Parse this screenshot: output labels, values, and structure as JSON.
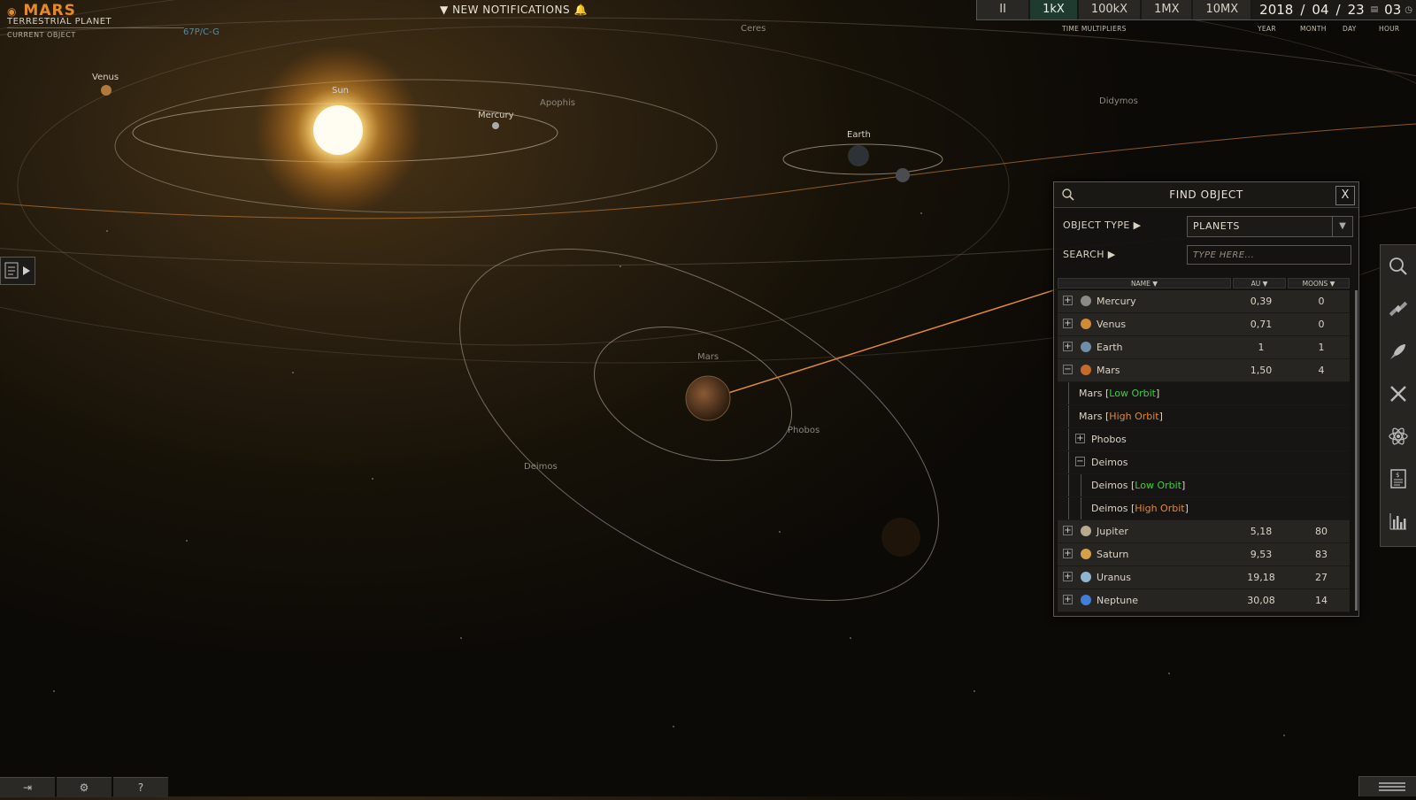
{
  "current_object": {
    "name": "MARS",
    "type": "TERRESTRIAL PLANET",
    "label": "CURRENT OBJECT",
    "code": "67P/C-G"
  },
  "notifications": {
    "label": "NEW NOTIFICATIONS"
  },
  "time_controls": {
    "pause": "II",
    "multipliers": [
      "1kX",
      "100kX",
      "1MX",
      "10MX"
    ],
    "active_multiplier": "1kX",
    "multipliers_label": "TIME MULTIPLIERS",
    "year": "2018",
    "month": "04",
    "day": "23",
    "hour": "03",
    "year_label": "YEAR",
    "month_label": "MONTH",
    "day_label": "DAY",
    "hour_label": "HOUR"
  },
  "scene_labels": {
    "venus": "Venus",
    "sun": "Sun",
    "mercury": "Mercury",
    "apophis": "Apophis",
    "ceres": "Ceres",
    "didymos": "Didymos",
    "earth": "Earth",
    "mars": "Mars",
    "phobos": "Phobos",
    "deimos": "Deimos"
  },
  "find_panel": {
    "title": "FIND OBJECT",
    "close": "X",
    "object_type_label": "OBJECT TYPE ▶",
    "object_type_value": "PLANETS",
    "search_label": "SEARCH ▶",
    "search_placeholder": "TYPE HERE...",
    "columns": {
      "name": "NAME ▼",
      "au": "AU ▼",
      "moons": "MOONS ▼"
    },
    "rows": [
      {
        "kind": "planet",
        "toggle": "+",
        "name": "Mercury",
        "au": "0,39",
        "moons": "0",
        "color": "#8c8a86"
      },
      {
        "kind": "planet",
        "toggle": "+",
        "name": "Venus",
        "au": "0,71",
        "moons": "0",
        "color": "#d18a35"
      },
      {
        "kind": "planet",
        "toggle": "+",
        "name": "Earth",
        "au": "1",
        "moons": "1",
        "color": "#6e8fa8"
      },
      {
        "kind": "planet",
        "toggle": "−",
        "name": "Mars",
        "au": "1,50",
        "moons": "4",
        "color": "#c46a2c"
      },
      {
        "kind": "orbit",
        "name": "Mars",
        "orbit": "Low Orbit",
        "orbit_color": "green",
        "level": 1
      },
      {
        "kind": "orbit",
        "name": "Mars",
        "orbit": "High Orbit",
        "orbit_color": "orange",
        "level": 1
      },
      {
        "kind": "moon",
        "toggle": "+",
        "name": "Phobos"
      },
      {
        "kind": "moon",
        "toggle": "−",
        "name": "Deimos"
      },
      {
        "kind": "orbit",
        "name": "Deimos",
        "orbit": "Low Orbit",
        "orbit_color": "green",
        "level": 2
      },
      {
        "kind": "orbit",
        "name": "Deimos",
        "orbit": "High Orbit",
        "orbit_color": "orange",
        "level": 2
      },
      {
        "kind": "planet",
        "toggle": "+",
        "name": "Jupiter",
        "au": "5,18",
        "moons": "80",
        "color": "#b9a98e"
      },
      {
        "kind": "planet",
        "toggle": "+",
        "name": "Saturn",
        "au": "9,53",
        "moons": "83",
        "color": "#d4a148"
      },
      {
        "kind": "planet",
        "toggle": "+",
        "name": "Uranus",
        "au": "19,18",
        "moons": "27",
        "color": "#8fb6d0"
      },
      {
        "kind": "planet",
        "toggle": "+",
        "name": "Neptune",
        "au": "30,08",
        "moons": "14",
        "color": "#3f7fd6"
      }
    ]
  },
  "right_toolbar": [
    "search-icon",
    "satellite-icon",
    "rocket-icon",
    "tools-icon",
    "atom-icon",
    "finance-report-icon",
    "bar-chart-icon"
  ],
  "bottom_bar": {
    "exit": "⇥",
    "settings": "⚙",
    "help": "?"
  }
}
